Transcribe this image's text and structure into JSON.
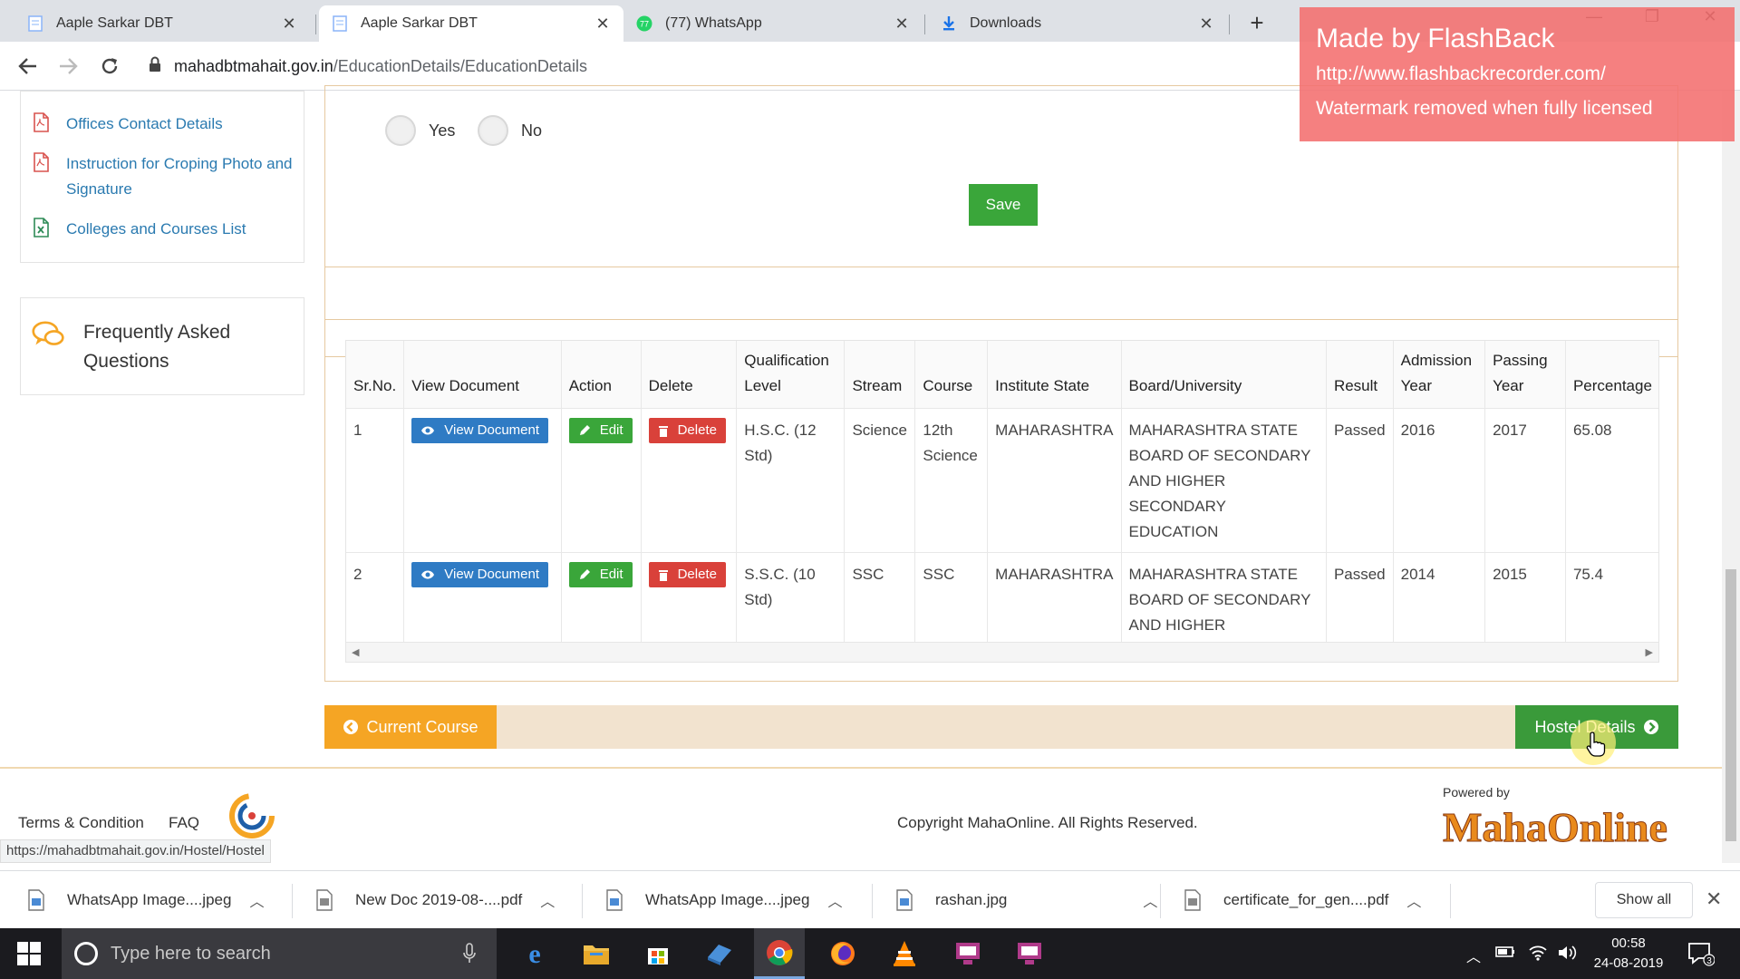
{
  "browser": {
    "tabs": [
      {
        "title": "Aaple Sarkar DBT",
        "active": false
      },
      {
        "title": "Aaple Sarkar DBT",
        "active": true
      },
      {
        "title": "(77) WhatsApp",
        "active": false
      },
      {
        "title": "Downloads",
        "active": false
      }
    ],
    "whatsapp_badge": "77",
    "url_host": "mahadbtmahait.gov.in",
    "url_path": "/EducationDetails/EducationDetails"
  },
  "watermark": {
    "line1": "Made by FlashBack",
    "line2": "http://www.flashbackrecorder.com/",
    "line3": "Watermark removed when fully licensed"
  },
  "sidebar": {
    "links": [
      {
        "label": "Offices Contact Details",
        "icon": "pdf-icon"
      },
      {
        "label": "Instruction for Croping Photo and Signature",
        "icon": "pdf-icon"
      },
      {
        "label": "Colleges and Courses List",
        "icon": "excel-icon"
      }
    ],
    "faq_label": "Frequently Asked Questions"
  },
  "form": {
    "radio_yes": "Yes",
    "radio_no": "No",
    "save_label": "Save"
  },
  "table": {
    "headers": [
      "Sr.No.",
      "View Document",
      "Action",
      "Delete",
      "Qualification Level",
      "Stream",
      "Course",
      "Institute State",
      "Board/University",
      "Result",
      "Admission Year",
      "Passing Year",
      "Percentage"
    ],
    "view_label": "View Document",
    "edit_label": "Edit",
    "delete_label": "Delete",
    "rows": [
      {
        "srno": "1",
        "qualification": "H.S.C. (12 Std)",
        "stream": "Science",
        "course": "12th Science",
        "state": "MAHARASHTRA",
        "board": "MAHARASHTRA STATE BOARD OF SECONDARY AND HIGHER SECONDARY EDUCATION",
        "result": "Passed",
        "admission_year": "2016",
        "passing_year": "2017",
        "percentage": "65.08"
      },
      {
        "srno": "2",
        "qualification": "S.S.C. (10 Std)",
        "stream": "SSC",
        "course": "SSC",
        "state": "MAHARASHTRA",
        "board": "MAHARASHTRA STATE BOARD OF SECONDARY AND HIGHER SECONDARY EDUCATION",
        "result": "Passed",
        "admission_year": "2014",
        "passing_year": "2015",
        "percentage": "75.4"
      }
    ]
  },
  "nav": {
    "prev_label": "Current Course",
    "next_label": "Hostel Details"
  },
  "footer": {
    "terms": "Terms & Condition",
    "faq": "FAQ",
    "copyright": "Copyright MahaOnline. All Rights Reserved.",
    "powered_by": "Powered by",
    "mahaonline_logo_text": "MahaOnline"
  },
  "status_url": "https://mahadbtmahait.gov.in/Hostel/Hostel",
  "downloads": {
    "items": [
      {
        "name": "WhatsApp Image....jpeg"
      },
      {
        "name": "New Doc 2019-08-....pdf"
      },
      {
        "name": "WhatsApp Image....jpeg"
      },
      {
        "name": "rashan.jpg"
      },
      {
        "name": "certificate_for_gen....pdf"
      }
    ],
    "show_all": "Show all"
  },
  "taskbar": {
    "search_placeholder": "Type here to search",
    "time": "00:58",
    "date": "24-08-2019",
    "notifications": "3"
  },
  "colors": {
    "link": "#2a7ab0",
    "save_green": "#3aa63a",
    "view_blue": "#2f7bc4",
    "delete_red": "#d9413a",
    "current_course_orange": "#f5a524",
    "border_tan": "#e6c9a0"
  }
}
